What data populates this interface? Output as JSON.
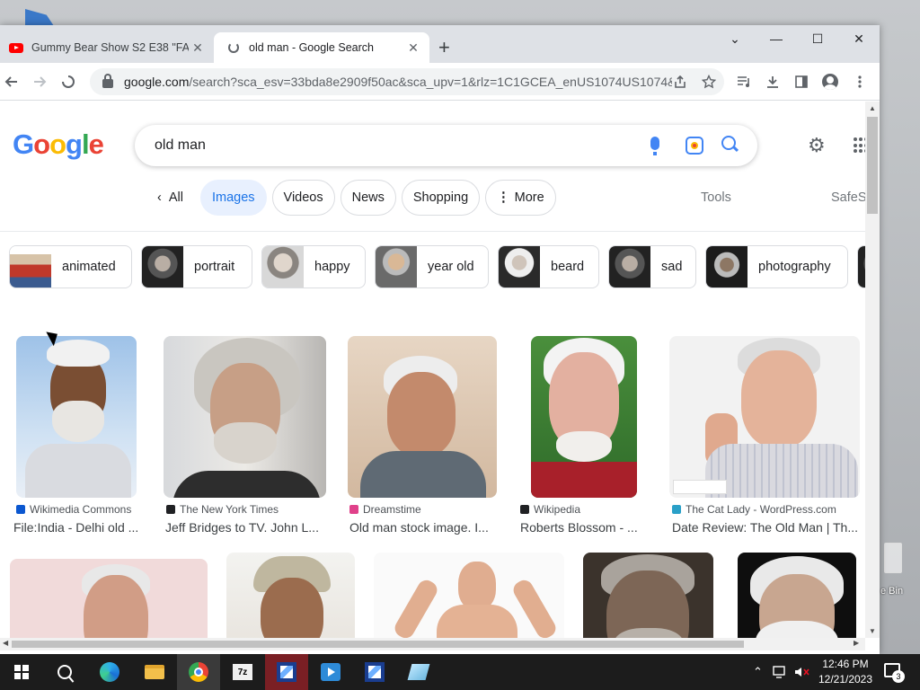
{
  "desktop": {
    "recycle_bin_label": "e Bin"
  },
  "browser": {
    "tabs": [
      {
        "title": "Gummy Bear Show S2 E38 \"FACT",
        "close": "✕"
      },
      {
        "title": "old man - Google Search",
        "close": "✕"
      }
    ],
    "new_tab": "+",
    "window_controls": {
      "tab_search": "⌄",
      "minimize": "—",
      "maximize": "☐",
      "close": "✕"
    },
    "url_host": "google.com",
    "url_rest": "/search?sca_esv=33bda8e2909f50ac&sca_upv=1&rlz=1C1GCEA_enUS1074US1074&..."
  },
  "search": {
    "query": "old man",
    "logo_letters": [
      "G",
      "o",
      "o",
      "g",
      "l",
      "e"
    ],
    "nav_tabs": {
      "all": "All",
      "images": "Images",
      "videos": "Videos",
      "news": "News",
      "shopping": "Shopping",
      "more": "More"
    },
    "tools": "Tools",
    "safesearch": "SafeS",
    "chips": [
      "animated",
      "portrait",
      "happy",
      "year old",
      "beard",
      "sad",
      "photography"
    ],
    "results_row1": [
      {
        "source": "Wikimedia Commons",
        "caption": "File:India - Delhi old ..."
      },
      {
        "source": "The New York Times",
        "caption": "Jeff Bridges to TV. John L..."
      },
      {
        "source": "Dreamstime",
        "caption": "Old man stock image. I..."
      },
      {
        "source": "Wikipedia",
        "caption": "Roberts Blossom - ..."
      },
      {
        "source": "The Cat Lady - WordPress.com",
        "caption": "Date Review: The Old Man | Th..."
      }
    ]
  },
  "taskbar": {
    "time": "12:46 PM",
    "date": "12/21/2023",
    "notification_count": "3"
  },
  "colors": {
    "accent_blue": "#1a73e8",
    "active_tab_bg": "#e8f0fe",
    "taskbar": "#1c1c1c"
  }
}
